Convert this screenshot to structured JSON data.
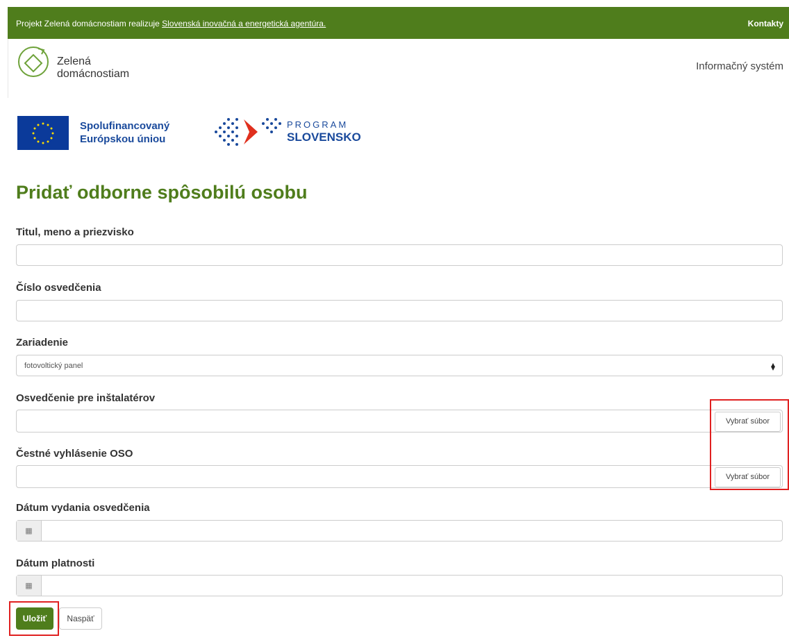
{
  "topbar": {
    "message_prefix": "Projekt Zelená domácnostiam realizuje",
    "agency_link": "Slovenská inovačná a energetická agentúra.",
    "contacts": "Kontakty"
  },
  "header": {
    "logo_line1": "Zelená",
    "logo_line2": "domácnostiam",
    "info_system": "Informačný systém"
  },
  "sponsors": {
    "eu_line1": "Spolufinancovaný",
    "eu_line2": "Európskou úniou",
    "program_line1": "PROGRAM",
    "program_line2": "SLOVENSKO"
  },
  "form": {
    "title": "Pridať odborne spôsobilú osobu",
    "name_label": "Titul, meno a priezvisko",
    "name_value": "",
    "cert_number_label": "Číslo osvedčenia",
    "cert_number_value": "",
    "device_label": "Zariadenie",
    "device_selected": "fotovoltický panel",
    "installer_cert_label": "Osvedčenie pre inštalatérov",
    "honor_decl_label": "Čestné vyhlásenie OSO",
    "choose_file": "Vybrať súbor",
    "issue_date_label": "Dátum vydania osvedčenia",
    "validity_label": "Dátum platnosti",
    "save_button": "Uložiť",
    "back_button": "Naspäť"
  },
  "colors": {
    "brand_green": "#4f7d1c",
    "highlight_red": "#e02020",
    "eu_blue": "#0b3a9a"
  }
}
